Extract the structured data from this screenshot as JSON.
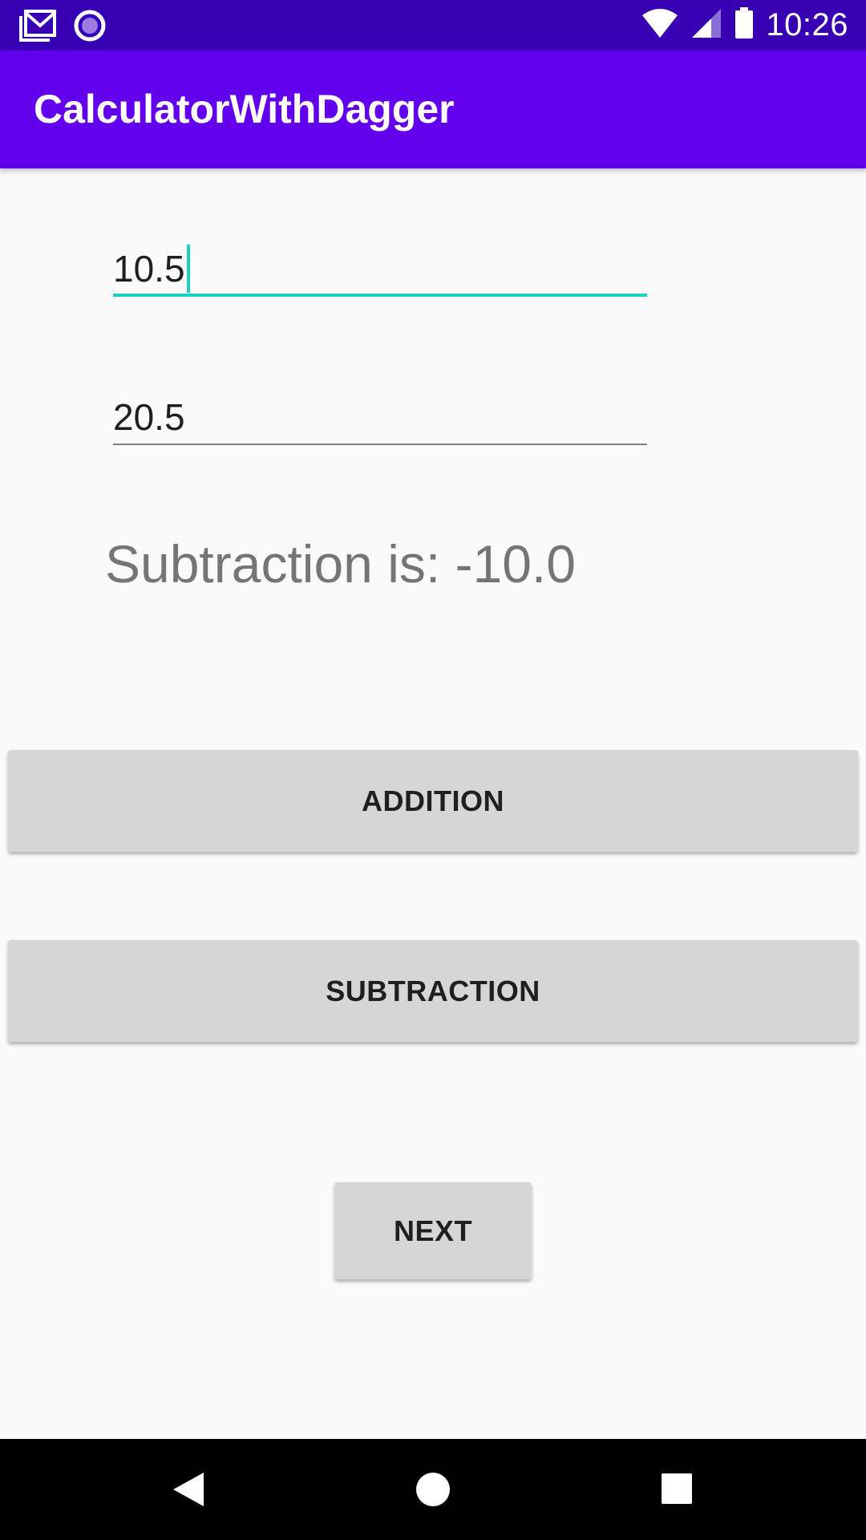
{
  "status_bar": {
    "time": "10:26",
    "icons": [
      "gmail-icon",
      "radio-icon",
      "wifi-icon",
      "signal-icon",
      "battery-icon"
    ]
  },
  "app_bar": {
    "title": "CalculatorWithDagger"
  },
  "inputs": {
    "first_value": "10.5",
    "second_value": "20.5"
  },
  "result_text": "Subtraction is: -10.0",
  "buttons": {
    "addition": "ADDITION",
    "subtraction": "SUBTRACTION",
    "next": "NEXT"
  },
  "nav_bar": {
    "icons": [
      "back-icon",
      "home-icon",
      "recents-icon"
    ]
  },
  "colors": {
    "status_bar": "#3700b3",
    "app_bar": "#6200ee",
    "accent": "#1bcfc4",
    "button": "#d6d6d6"
  }
}
